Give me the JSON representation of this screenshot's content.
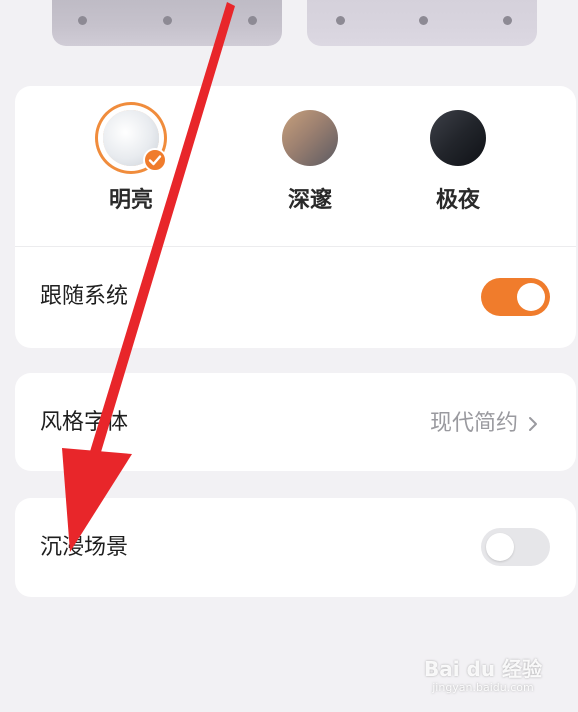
{
  "theme_options": [
    {
      "label": "明亮",
      "selected": true
    },
    {
      "label": "深邃",
      "selected": false
    },
    {
      "label": "极夜",
      "selected": false
    }
  ],
  "follow_system": {
    "label": "跟随系统",
    "enabled": true
  },
  "style": {
    "label": "风格字体",
    "value": "现代简约"
  },
  "immersive": {
    "label": "沉浸场景",
    "enabled": false
  },
  "colors": {
    "accent": "#f07c2c",
    "annotation_arrow": "#e8262a",
    "background": "#f2f1f4"
  },
  "watermark": {
    "main": "Bai du 经验",
    "sub": "jingyan.baidu.com"
  }
}
